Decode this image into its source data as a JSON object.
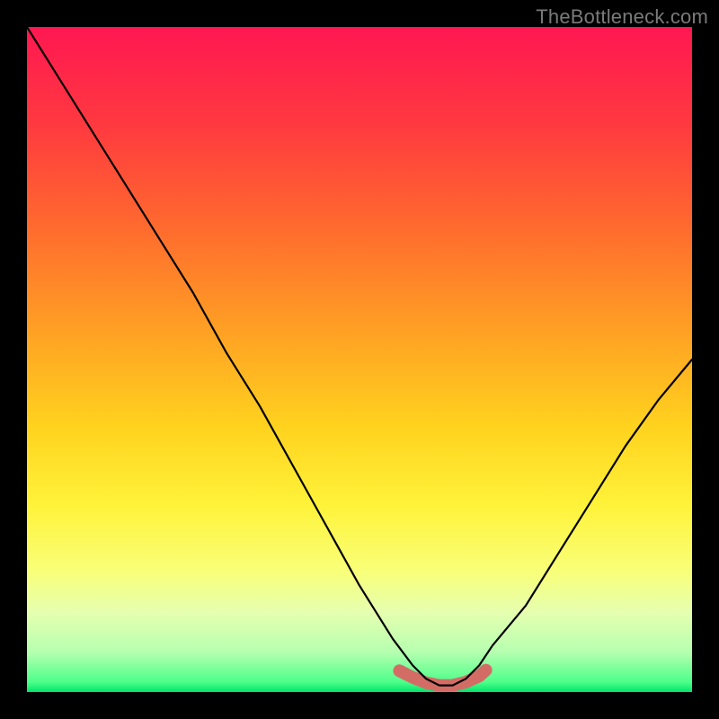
{
  "watermark": {
    "text": "TheBottleneck.com"
  },
  "chart_data": {
    "type": "line",
    "title": "",
    "xlabel": "",
    "ylabel": "",
    "xlim": [
      0,
      100
    ],
    "ylim": [
      0,
      100
    ],
    "x": [
      0,
      5,
      10,
      15,
      20,
      25,
      30,
      35,
      40,
      45,
      50,
      55,
      58,
      60,
      62,
      64,
      66,
      68,
      70,
      75,
      80,
      85,
      90,
      95,
      100
    ],
    "values": [
      100,
      92,
      84,
      76,
      68,
      60,
      51,
      43,
      34,
      25,
      16,
      8,
      4,
      2,
      1,
      1,
      2,
      4,
      7,
      13,
      21,
      29,
      37,
      44,
      50
    ],
    "series": [
      {
        "name": "performance-curve",
        "x": [
          0,
          5,
          10,
          15,
          20,
          25,
          30,
          35,
          40,
          45,
          50,
          55,
          58,
          60,
          62,
          64,
          66,
          68,
          70,
          75,
          80,
          85,
          90,
          95,
          100
        ],
        "values": [
          100,
          92,
          84,
          76,
          68,
          60,
          51,
          43,
          34,
          25,
          16,
          8,
          4,
          2,
          1,
          1,
          2,
          4,
          7,
          13,
          21,
          29,
          37,
          44,
          50
        ]
      },
      {
        "name": "optimal-band",
        "x": [
          56,
          58,
          60,
          62,
          64,
          66,
          68,
          69
        ],
        "values": [
          3.2,
          2.2,
          1.4,
          1.0,
          1.0,
          1.5,
          2.4,
          3.3
        ]
      }
    ],
    "gradient_stops": [
      {
        "offset": 0.0,
        "color": "#ff1752"
      },
      {
        "offset": 0.15,
        "color": "#ff3a3f"
      },
      {
        "offset": 0.3,
        "color": "#ff6a2e"
      },
      {
        "offset": 0.45,
        "color": "#ff9e24"
      },
      {
        "offset": 0.6,
        "color": "#ffd21e"
      },
      {
        "offset": 0.72,
        "color": "#fff33a"
      },
      {
        "offset": 0.82,
        "color": "#f8ff7a"
      },
      {
        "offset": 0.88,
        "color": "#e6ffb0"
      },
      {
        "offset": 0.94,
        "color": "#b6ffb0"
      },
      {
        "offset": 0.985,
        "color": "#4dff8a"
      },
      {
        "offset": 1.0,
        "color": "#00e36a"
      }
    ],
    "optimal_band_style": {
      "stroke": "#d46c66",
      "stroke_width": 14,
      "linecap": "round"
    },
    "curve_style": {
      "stroke": "#000000",
      "stroke_width": 2.2
    }
  }
}
